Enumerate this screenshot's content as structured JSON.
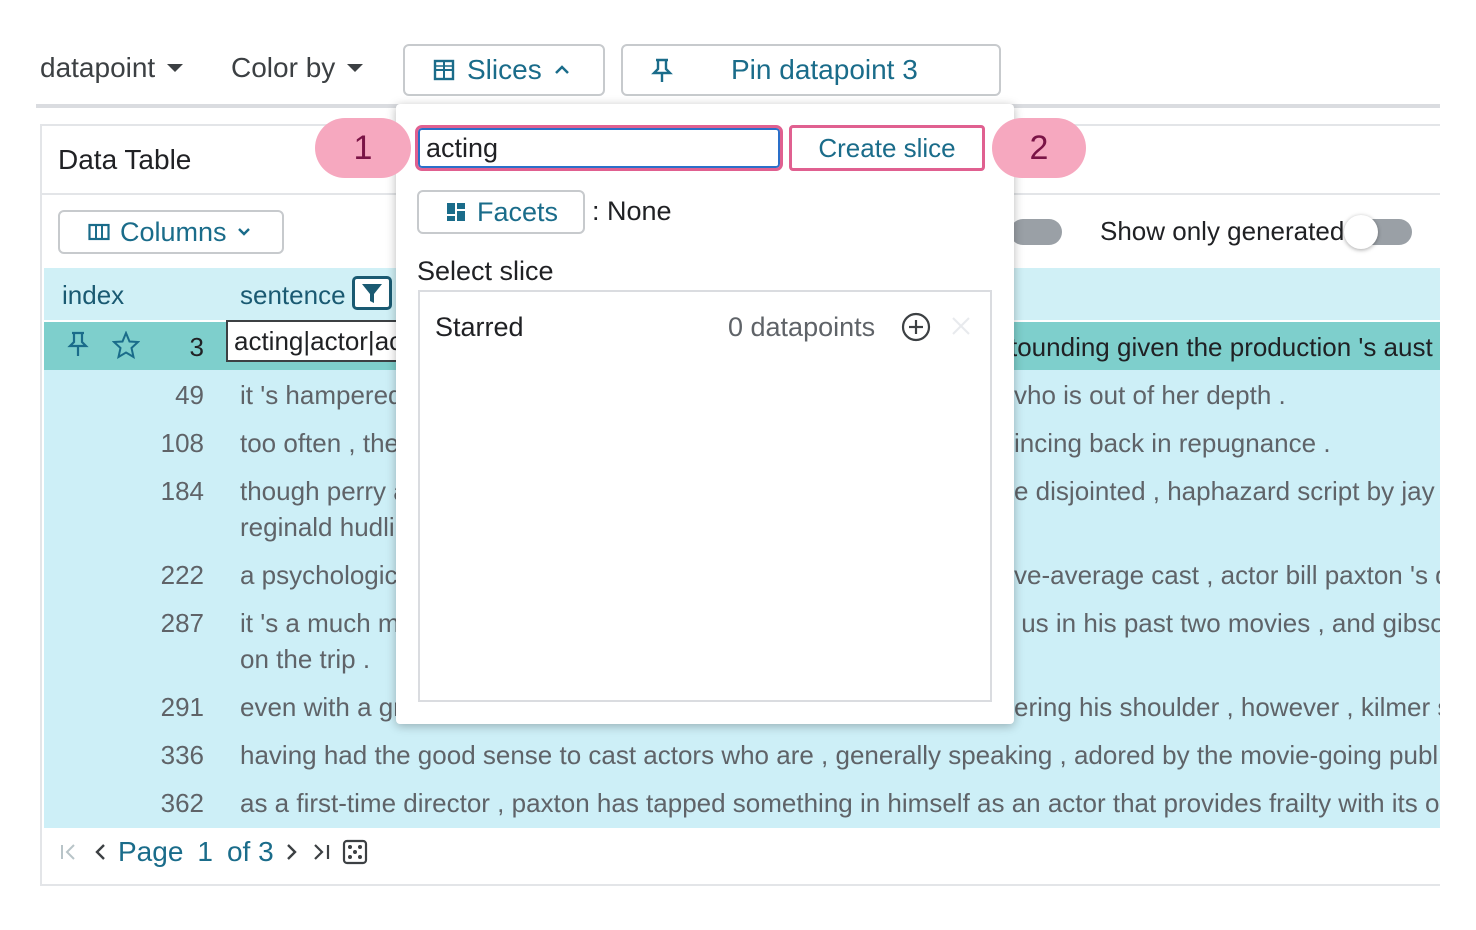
{
  "toolbar": {
    "datapoint_label": "datapoint",
    "color_by_label": "Color by",
    "slices_label": "Slices",
    "pin_label": "Pin datapoint 3"
  },
  "table": {
    "title": "Data Table",
    "columns_button": "Columns",
    "show_only_generated": "Show only generated",
    "headers": {
      "index": "index",
      "sentence": "sentence"
    },
    "selected_row": {
      "index": "3",
      "filter_value": "acting|actor|ac",
      "text_tail": "tounding given the production 's aust"
    },
    "rows": [
      {
        "index": "49",
        "left": "it 's hampered",
        "right": "vho is out of her depth .",
        "line2": ""
      },
      {
        "index": "108",
        "left": "too often , the",
        "right": "incing back in repugnance .",
        "line2": ""
      },
      {
        "index": "184",
        "left": "though perry a",
        "right": "e disjointed , haphazard script by jay",
        "line2": "reginald hudli"
      },
      {
        "index": "222",
        "left": "a psychologic",
        "right": "ve-average cast , actor bill paxton 's d",
        "line2": ""
      },
      {
        "index": "287",
        "left": "it 's a much m",
        "right": " us in his past two movies , and gibso",
        "line2": "on the trip ."
      },
      {
        "index": "291",
        "left": "even with a gr",
        "right": "ering his shoulder , however , kilmer s",
        "line2": ""
      },
      {
        "index": "336",
        "full": "having had the good sense to cast actors who are , generally speaking , adored by the movie-going public"
      },
      {
        "index": "362",
        "full": "as a first-time director , paxton has tapped something in himself as an actor that provides frailty with its o"
      }
    ],
    "pager": {
      "page_word": "Page",
      "page_num": "1",
      "of_text": "of 3"
    }
  },
  "slices_popup": {
    "search_value": "acting",
    "create_label": "Create slice",
    "facets_label": "Facets",
    "facets_value": ": None",
    "select_heading": "Select slice",
    "slices": [
      {
        "name": "Starred",
        "count": "0 datapoints"
      }
    ]
  },
  "badges": {
    "one": "1",
    "two": "2"
  },
  "colors": {
    "accent": "#1a6c8a",
    "selected_row": "#7ecfcc",
    "row_bg": "#cdeff7",
    "badge": "#f6a8bf",
    "highlight": "#e06090"
  }
}
